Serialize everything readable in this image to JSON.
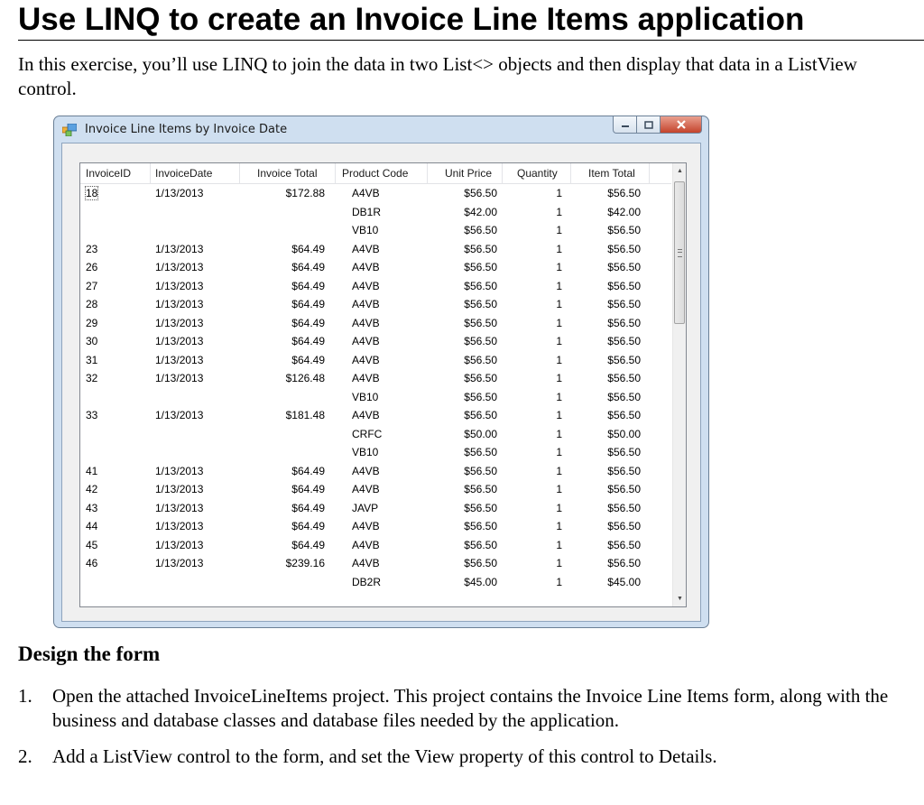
{
  "page": {
    "heading": "Use LINQ to create an Invoice Line Items application",
    "intro": "In this exercise, you’ll use LINQ to join the data in two List<> objects and then display that data in a ListView control.",
    "section_heading": "Design the form",
    "steps": [
      {
        "num": "1.",
        "text": "Open the attached InvoiceLineItems project. This project contains the Invoice Line Items form, along with the business and database classes and database files needed by the application."
      },
      {
        "num": "2.",
        "text": "Add a ListView control to the form, and set the View property of this control to Details."
      }
    ]
  },
  "window": {
    "title": "Invoice Line Items by Invoice Date",
    "columns": [
      "InvoiceID",
      "InvoiceDate",
      "Invoice Total",
      "Product Code",
      "Unit Price",
      "Quantity",
      "Item Total"
    ],
    "rows": [
      [
        "18",
        "1/13/2013",
        "$172.88",
        "A4VB",
        "$56.50",
        "1",
        "$56.50"
      ],
      [
        "",
        "",
        "",
        "DB1R",
        "$42.00",
        "1",
        "$42.00"
      ],
      [
        "",
        "",
        "",
        "VB10",
        "$56.50",
        "1",
        "$56.50"
      ],
      [
        "23",
        "1/13/2013",
        "$64.49",
        "A4VB",
        "$56.50",
        "1",
        "$56.50"
      ],
      [
        "26",
        "1/13/2013",
        "$64.49",
        "A4VB",
        "$56.50",
        "1",
        "$56.50"
      ],
      [
        "27",
        "1/13/2013",
        "$64.49",
        "A4VB",
        "$56.50",
        "1",
        "$56.50"
      ],
      [
        "28",
        "1/13/2013",
        "$64.49",
        "A4VB",
        "$56.50",
        "1",
        "$56.50"
      ],
      [
        "29",
        "1/13/2013",
        "$64.49",
        "A4VB",
        "$56.50",
        "1",
        "$56.50"
      ],
      [
        "30",
        "1/13/2013",
        "$64.49",
        "A4VB",
        "$56.50",
        "1",
        "$56.50"
      ],
      [
        "31",
        "1/13/2013",
        "$64.49",
        "A4VB",
        "$56.50",
        "1",
        "$56.50"
      ],
      [
        "32",
        "1/13/2013",
        "$126.48",
        "A4VB",
        "$56.50",
        "1",
        "$56.50"
      ],
      [
        "",
        "",
        "",
        "VB10",
        "$56.50",
        "1",
        "$56.50"
      ],
      [
        "33",
        "1/13/2013",
        "$181.48",
        "A4VB",
        "$56.50",
        "1",
        "$56.50"
      ],
      [
        "",
        "",
        "",
        "CRFC",
        "$50.00",
        "1",
        "$50.00"
      ],
      [
        "",
        "",
        "",
        "VB10",
        "$56.50",
        "1",
        "$56.50"
      ],
      [
        "41",
        "1/13/2013",
        "$64.49",
        "A4VB",
        "$56.50",
        "1",
        "$56.50"
      ],
      [
        "42",
        "1/13/2013",
        "$64.49",
        "A4VB",
        "$56.50",
        "1",
        "$56.50"
      ],
      [
        "43",
        "1/13/2013",
        "$64.49",
        "JAVP",
        "$56.50",
        "1",
        "$56.50"
      ],
      [
        "44",
        "1/13/2013",
        "$64.49",
        "A4VB",
        "$56.50",
        "1",
        "$56.50"
      ],
      [
        "45",
        "1/13/2013",
        "$64.49",
        "A4VB",
        "$56.50",
        "1",
        "$56.50"
      ],
      [
        "46",
        "1/13/2013",
        "$239.16",
        "A4VB",
        "$56.50",
        "1",
        "$56.50"
      ],
      [
        "",
        "",
        "",
        "DB2R",
        "$45.00",
        "1",
        "$45.00"
      ]
    ]
  },
  "icons": {
    "app": "app-form-icon",
    "minimize": "minimize-icon",
    "maximize": "maximize-icon",
    "close": "close-icon",
    "scroll_up": "scroll-up-arrow-icon",
    "scroll_down": "scroll-down-arrow-icon"
  },
  "colors": {
    "window_frame": "#cfdff0",
    "close_button": "#c4432c"
  }
}
